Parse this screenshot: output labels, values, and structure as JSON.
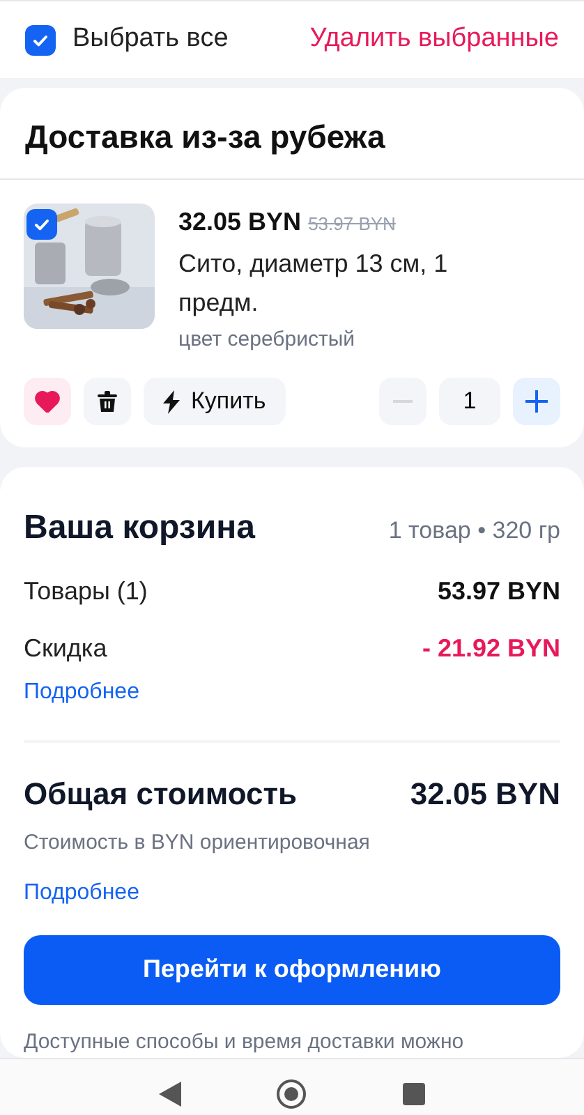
{
  "toolbar": {
    "select_all": {
      "label": "Выбрать все",
      "checked": true
    },
    "delete_selected": "Удалить выбранные"
  },
  "shipment": {
    "title": "Доставка из-за рубежа",
    "items": [
      {
        "checked": true,
        "price": "32.05 BYN",
        "old_price": "53.97 BYN",
        "name": "Сито, диаметр 13 см, 1 предм.",
        "variant": "цвет серебристый",
        "favorite": true,
        "buy_label": "Купить",
        "quantity": "1",
        "decrease_disabled": true
      }
    ]
  },
  "summary": {
    "title": "Ваша корзина",
    "meta": "1 товар • 320 гр",
    "rows": [
      {
        "label": "Товары (1)",
        "value": "53.97 BYN",
        "kind": "plain"
      },
      {
        "label": "Скидка",
        "value": "- 21.92 BYN",
        "kind": "discount"
      }
    ],
    "details_link": "Подробнее",
    "total_label": "Общая стоимость",
    "total_value": "32.05 BYN",
    "note": "Стоимость в BYN ориентировочная",
    "note_link": "Подробнее",
    "checkout": "Перейти к оформлению",
    "delivery_note": "Доступные способы и время доставки можно"
  }
}
